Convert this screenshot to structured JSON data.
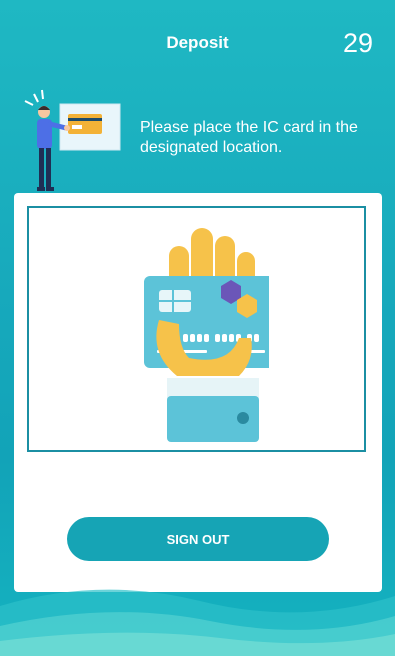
{
  "header": {
    "title": "Deposit",
    "countdown": "29"
  },
  "instruction": {
    "text": "Please place the IC card in the designated location.",
    "icon": "person-presenting-card-icon"
  },
  "illustration": {
    "icon": "hand-holding-ic-card-icon"
  },
  "actions": {
    "signout_label": "SIGN OUT"
  },
  "colors": {
    "accent": "#16a4b5",
    "frame_border": "#1b8fa3",
    "panel_bg": "#ffffff"
  }
}
